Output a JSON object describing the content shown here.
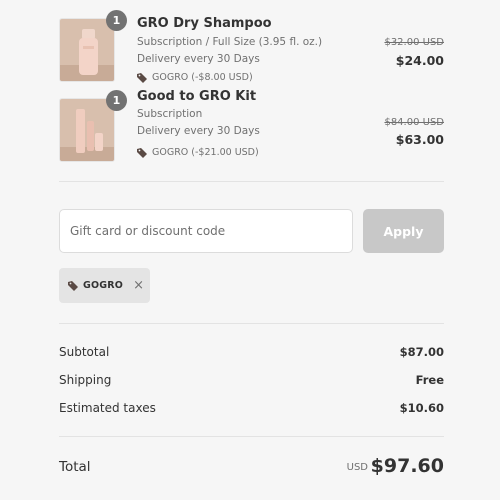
{
  "items": [
    {
      "quantity": "1",
      "title": "GRO Dry Shampoo",
      "variant": "Subscription / Full Size (3.95 fl. oz.)",
      "delivery": "Delivery every 30 Days",
      "discount": "GOGRO (-$8.00 USD)",
      "price_original": "$32.00 USD",
      "price": "$24.00"
    },
    {
      "quantity": "1",
      "title": "Good to GRO Kit",
      "variant": "Subscription",
      "delivery": "Delivery every 30 Days",
      "discount": "GOGRO (-$21.00 USD)",
      "price_original": "$84.00 USD",
      "price": "$63.00"
    }
  ],
  "discount_form": {
    "placeholder": "Gift card or discount code",
    "apply_label": "Apply"
  },
  "applied_code": {
    "code": "GOGRO",
    "remove_glyph": "×"
  },
  "summary": {
    "subtotal_label": "Subtotal",
    "subtotal_value": "$87.00",
    "shipping_label": "Shipping",
    "shipping_value": "Free",
    "taxes_label": "Estimated taxes",
    "taxes_value": "$10.60",
    "total_label": "Total",
    "total_currency": "USD",
    "total_value": "$97.60"
  },
  "colors": {
    "background": "#f6f6f6",
    "apply_button": "#c8c8c8",
    "quantity_badge": "#727272",
    "tag_icon": "#5a4a44"
  },
  "icons": {
    "tag": "tag-icon",
    "remove": "close-icon"
  }
}
